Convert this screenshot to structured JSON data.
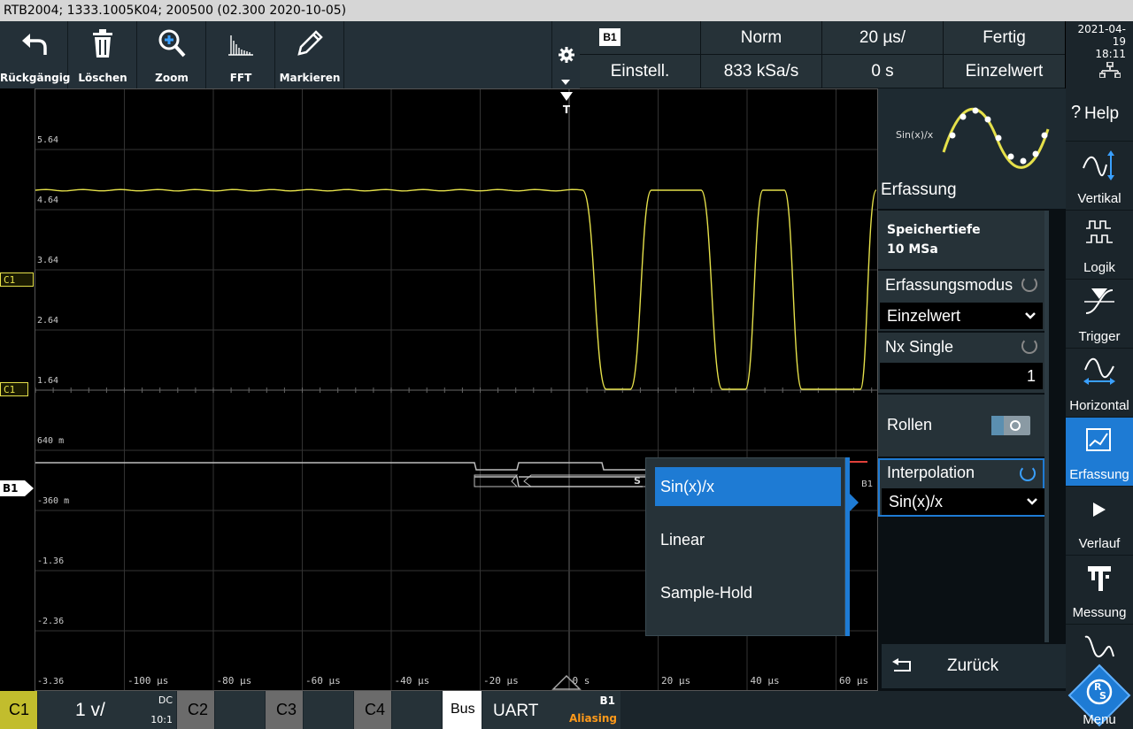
{
  "titlebar": {
    "text": "RTB2004; 1333.1005K04; 200500 (02.300 2020-10-05)"
  },
  "toolbar": {
    "undo": "Rückgängig",
    "delete": "Löschen",
    "zoom": "Zoom",
    "fft": "FFT",
    "mark": "Markieren"
  },
  "status": {
    "badge": "B1",
    "trigger_mode": "Norm",
    "timebase": "20 µs/",
    "state": "Fertig",
    "setup": "Einstell.",
    "sample_rate": "833 kSa/s",
    "offset": "0 s",
    "acq_mode": "Einzelwert"
  },
  "datetime": {
    "date": "2021-04-19",
    "time": "18:11"
  },
  "plot": {
    "ylabels": [
      "5.64",
      "4.64",
      "3.64",
      "2.64",
      "1.64",
      "640 m",
      "-360 m",
      "-1.36",
      "-2.36",
      "-3.36"
    ],
    "xlabels": [
      "-100 µs",
      "-80 µs",
      "-60 µs",
      "-40 µs",
      "-20 µs",
      "0 s",
      "20 µs",
      "40 µs",
      "60 µs"
    ],
    "trigger_marker": "T",
    "bus_symbol": "S",
    "bus_tag": "B1"
  },
  "markers": {
    "c1_trigger": "C1",
    "c1": "C1",
    "b1": "B1"
  },
  "panel": {
    "preview_label": "Sin(x)/x",
    "title": "Erfassung",
    "memory_label": "Speichertiefe",
    "memory_value": "10 MSa",
    "acq_mode_label": "Erfassungsmodus",
    "acq_mode_value": "Einzelwert",
    "nx_label": "Nx Single",
    "nx_value": "1",
    "roll_label": "Rollen",
    "interp_label": "Interpolation",
    "interp_value": "Sin(x)/x",
    "back": "Zurück"
  },
  "popup": {
    "items": [
      "Sin(x)/x",
      "Linear",
      "Sample-Hold"
    ],
    "selected": 0
  },
  "nav": {
    "help": "Help",
    "vertical": "Vertikal",
    "logic": "Logik",
    "trigger": "Trigger",
    "horizontal": "Horizontal",
    "acquisition": "Erfassung",
    "history": "Verlauf",
    "measure": "Messung",
    "menu": "Menu"
  },
  "bottom": {
    "c1": "C1",
    "c1_scale": "1 v/",
    "c1_coupling": "DC",
    "c1_probe": "10:1",
    "c2": "C2",
    "c3": "C3",
    "c4": "C4",
    "bus": "Bus",
    "bus_proto": "UART",
    "bus_id": "B1",
    "bus_warn": "Aliasing"
  },
  "colors": {
    "ch1": "#e5e04a",
    "accent": "#1e7bd4",
    "bus": "#bdbdbd"
  }
}
